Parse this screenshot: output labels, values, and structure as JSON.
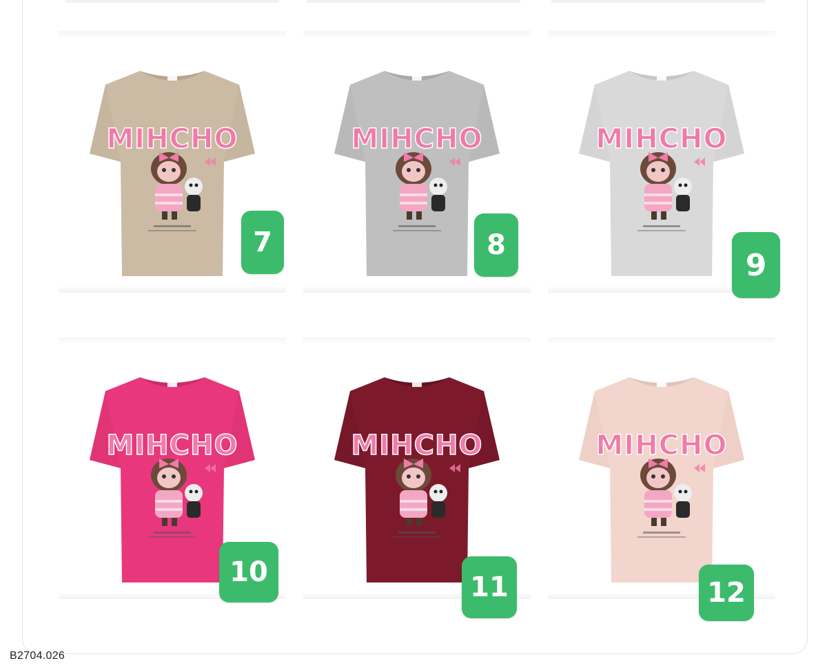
{
  "product_code": "B2704.026",
  "shirt_print_text": "MIHCHO",
  "products": [
    {
      "number": "7",
      "color": "#cbbba4",
      "color_dark": "#b6a68e"
    },
    {
      "number": "8",
      "color": "#bfbfbf",
      "color_dark": "#a9a9a9"
    },
    {
      "number": "9",
      "color": "#d9d9d9",
      "color_dark": "#c6c6c6"
    },
    {
      "number": "10",
      "color": "#e8377c",
      "color_dark": "#cc2a68"
    },
    {
      "number": "11",
      "color": "#7c1a2b",
      "color_dark": "#651322"
    },
    {
      "number": "12",
      "color": "#f2d5cd",
      "color_dark": "#e2c2b9"
    }
  ],
  "colors": {
    "badge": "#3cbb6c",
    "print_pink": "#f07aa8"
  }
}
